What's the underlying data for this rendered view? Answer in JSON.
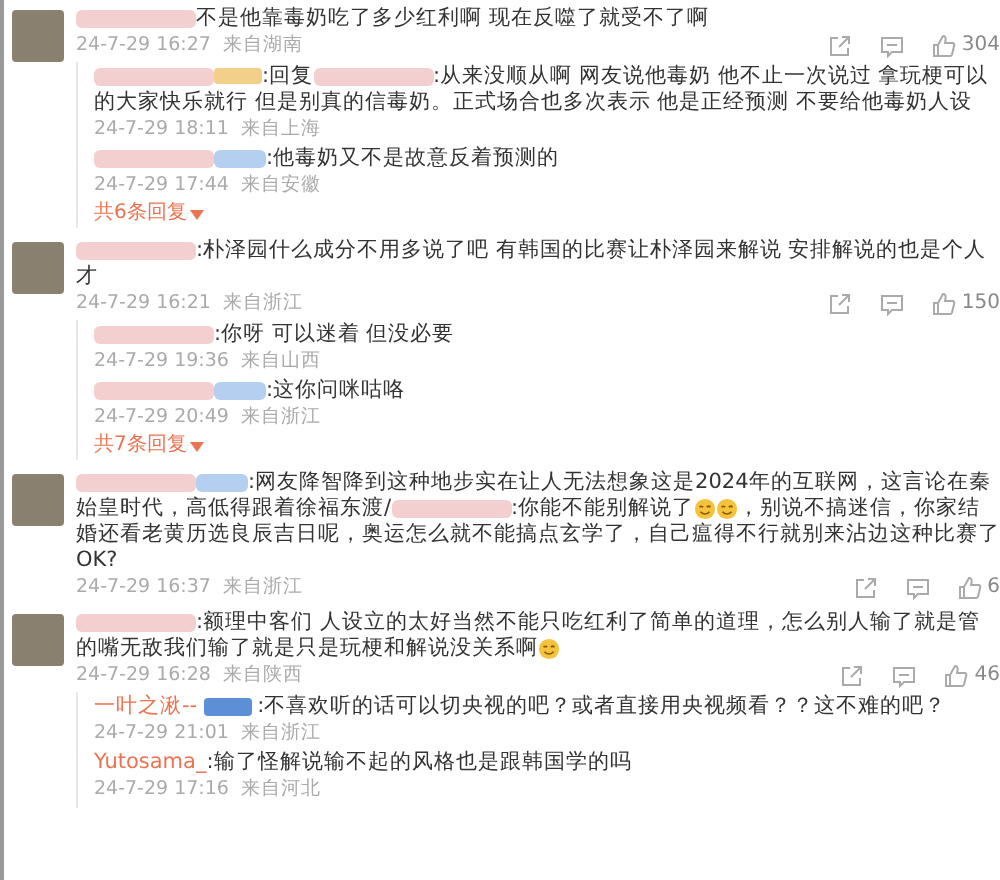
{
  "comments": [
    {
      "segments": [
        {
          "kind": "blur"
        },
        {
          "kind": "text",
          "text": "不是他靠毒奶吃了多少红利啊  现在反噬了就受不了啊"
        }
      ],
      "time": "24-7-29 16:27",
      "location": "来自湖南",
      "likes": "304",
      "replies": [
        {
          "segments": [
            {
              "kind": "blur"
            },
            {
              "kind": "blur-tag"
            },
            {
              "kind": "text",
              "text": ":回复"
            },
            {
              "kind": "blur"
            },
            {
              "kind": "text",
              "text": ":从来没顺从啊 网友说他毒奶 他不止一次说过 拿玩梗可以的大家快乐就行 但是别真的信毒奶。正式场合也多次表示 他是正经预测 不要给他毒奶人设"
            }
          ],
          "time": "24-7-29 18:11",
          "location": "来自上海"
        },
        {
          "segments": [
            {
              "kind": "blur"
            },
            {
              "kind": "blur-blue"
            },
            {
              "kind": "text",
              "text": ":他毒奶又不是故意反着预测的"
            }
          ],
          "time": "24-7-29 17:44",
          "location": "来自安徽"
        }
      ],
      "more_replies": "共6条回复"
    },
    {
      "segments": [
        {
          "kind": "blur"
        },
        {
          "kind": "text",
          "text": ":朴泽园什么成分不用多说了吧 有韩国的比赛让朴泽园来解说 安排解说的也是个人才"
        }
      ],
      "time": "24-7-29 16:21",
      "location": "来自浙江",
      "likes": "150",
      "replies": [
        {
          "segments": [
            {
              "kind": "blur"
            },
            {
              "kind": "text",
              "text": ":你呀 可以迷着 但没必要"
            }
          ],
          "time": "24-7-29 19:36",
          "location": "来自山西"
        },
        {
          "segments": [
            {
              "kind": "blur"
            },
            {
              "kind": "blur-blue"
            },
            {
              "kind": "text",
              "text": ":这你问咪咕咯"
            }
          ],
          "time": "24-7-29 20:49",
          "location": "来自浙江"
        }
      ],
      "more_replies": "共7条回复"
    },
    {
      "segments": [
        {
          "kind": "blur"
        },
        {
          "kind": "blur-blue"
        },
        {
          "kind": "text",
          "text": ":网友降智降到这种地步实在让人无法想象这是2024年的互联网，这言论在秦始皇时代，高低得跟着徐福东渡/"
        },
        {
          "kind": "blur"
        },
        {
          "kind": "text",
          "text": ":你能不能别解说了"
        },
        {
          "kind": "emoji"
        },
        {
          "kind": "emoji"
        },
        {
          "kind": "text",
          "text": "，别说不搞迷信，你家结婚还看老黄历选良辰吉日呢，奥运怎么就不能搞点玄学了，自己瘟得不行就别来沾边这种比赛了OK?"
        }
      ],
      "time": "24-7-29 16:37",
      "location": "来自浙江",
      "likes": "6"
    },
    {
      "segments": [
        {
          "kind": "blur"
        },
        {
          "kind": "text",
          "text": ":额理中客们 人设立的太好当然不能只吃红利了简单的道理，怎么别人输了就是管的嘴无敌我们输了就是只是玩梗和解说没关系啊"
        },
        {
          "kind": "emoji"
        }
      ],
      "time": "24-7-29 16:28",
      "location": "来自陕西",
      "likes": "46",
      "replies": [
        {
          "segments": [
            {
              "kind": "name",
              "text": "一叶之湫--"
            },
            {
              "kind": "badge"
            },
            {
              "kind": "text",
              "text": ":不喜欢听的话可以切央视的吧？或者直接用央视频看？？这不难的吧？"
            }
          ],
          "time": "24-7-29 21:01",
          "location": "来自浙江"
        },
        {
          "segments": [
            {
              "kind": "name",
              "text": "Yutosama_"
            },
            {
              "kind": "text",
              "text": ":输了怪解说输不起的风格也是跟韩国学的吗"
            }
          ],
          "time": "24-7-29 17:16",
          "location": "来自河北"
        }
      ]
    }
  ]
}
